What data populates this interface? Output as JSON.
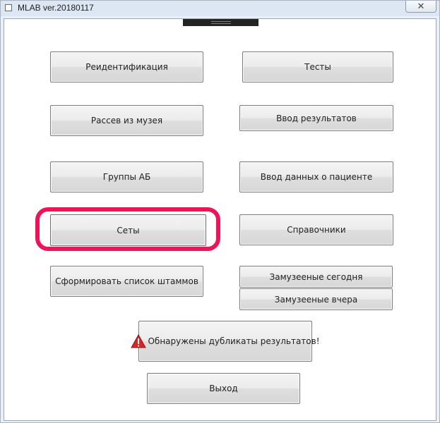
{
  "window": {
    "title": "MLAB ver.20180117",
    "close_glyph": "✕"
  },
  "buttons": {
    "reidentification": "Реидентификация",
    "tests": "Тесты",
    "museum_seeding": "Рассев из музея",
    "results_entry": "Ввод результатов",
    "ab_groups": "Группы АБ",
    "patient_data_entry": "Ввод данных о пациенте",
    "sets": "Сеты",
    "references": "Справочники",
    "form_strain_list": "Сформировать список штаммов",
    "museumed_today": "Замузееные сегодня",
    "museumed_yesterday": "Замузееные вчера",
    "duplicates_found": "Обнаружены дубликаты результатов!",
    "exit": "Выход"
  },
  "icons": {
    "app": "window-icon",
    "warning": "warning-icon"
  },
  "colors": {
    "highlight": "#ec155a",
    "warning": "#d62828"
  }
}
